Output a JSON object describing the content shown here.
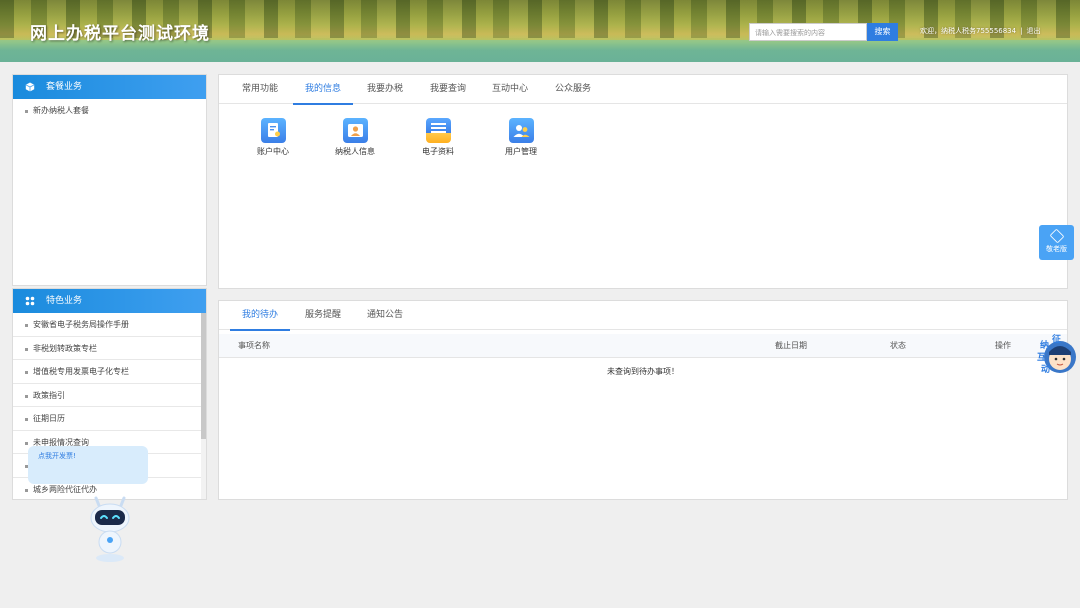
{
  "header": {
    "title": "网上办税平台测试环境",
    "search_placeholder": "请输入需要搜索的内容",
    "search_button": "搜索",
    "user_text": "欢迎，纳税人税务755556834",
    "logout": "退出"
  },
  "package_panel": {
    "title": "套餐业务",
    "items": [
      "新办纳税人套餐"
    ]
  },
  "special_panel": {
    "title": "特色业务",
    "items": [
      "安徽省电子税务局操作手册",
      "非税划转政策专栏",
      "增值税专用发票电子化专栏",
      "政策指引",
      "征期日历",
      "未申报情况查询",
      "",
      "城乡两险代征代办"
    ]
  },
  "top_tabs": [
    "常用功能",
    "我的信息",
    "我要办税",
    "我要查询",
    "互动中心",
    "公众服务"
  ],
  "top_tabs_active": 1,
  "functions": [
    {
      "label": "账户中心",
      "icon": "document-user-icon"
    },
    {
      "label": "纳税人信息",
      "icon": "person-card-icon"
    },
    {
      "label": "电子资料",
      "icon": "folder-stack-icon"
    },
    {
      "label": "用户管理",
      "icon": "users-icon"
    }
  ],
  "bottom_tabs": [
    "我的待办",
    "服务提醒",
    "通知公告"
  ],
  "bottom_tabs_active": 0,
  "todo_table": {
    "columns": [
      "事项名称",
      "截止日期",
      "状态",
      "操作"
    ],
    "empty_message": "未查询到待办事项！"
  },
  "elder_mode": {
    "label": "敬老版"
  },
  "assistant_bubble": {
    "text": "点我开发票!"
  },
  "mascot": {
    "chars": [
      "征",
      "纳",
      "互",
      "动"
    ]
  },
  "colors": {
    "primary": "#2f7de1",
    "panel_head": "#1a8bdd"
  }
}
